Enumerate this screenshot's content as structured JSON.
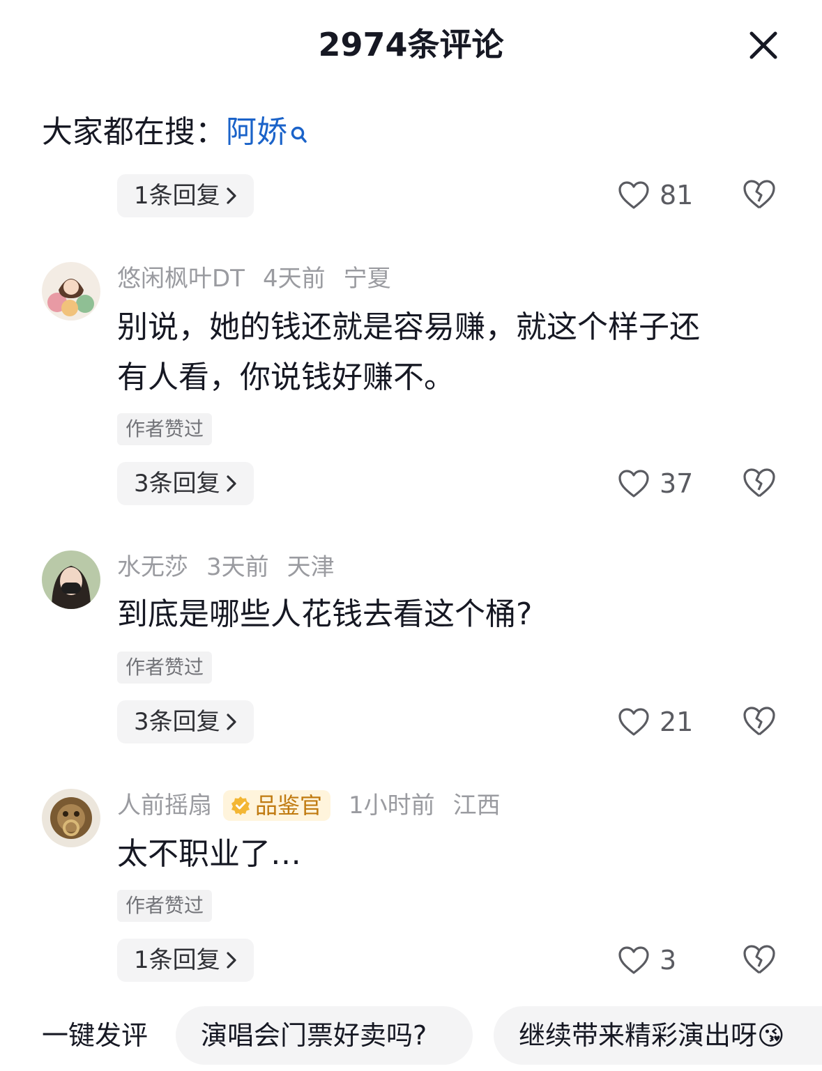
{
  "header": {
    "title": "2974条评论"
  },
  "search": {
    "prefix": "大家都在搜：",
    "term": "阿娇"
  },
  "top_item": {
    "replies": "1条回复",
    "likes": "81"
  },
  "comments": [
    {
      "username": "悠闲枫叶DT",
      "time": "4天前",
      "location": "宁夏",
      "text_line1": "别说，她的钱还就是容易赚，就这个样子还",
      "text_line2": "有人看，你说钱好赚不。",
      "author_liked": "作者赞过",
      "replies": "3条回复",
      "likes": "37"
    },
    {
      "username": "水无莎",
      "time": "3天前",
      "location": "天津",
      "text_line1": "到底是哪些人花钱去看这个桶?",
      "author_liked": "作者赞过",
      "replies": "3条回复",
      "likes": "21"
    },
    {
      "username": "人前摇扇",
      "badge": "品鉴官",
      "time": "1小时前",
      "location": "江西",
      "text_line1": "太不职业了…",
      "author_liked": "作者赞过",
      "replies": "1条回复",
      "likes": "3"
    }
  ],
  "quick_reply": {
    "label": "一键发评",
    "chips": [
      "演唱会门票好卖吗?",
      "继续带来精彩演出呀😘"
    ]
  },
  "colors": {
    "link": "#1b63c9",
    "badge_bg": "#fff4dc",
    "badge_text": "#c07a10"
  }
}
